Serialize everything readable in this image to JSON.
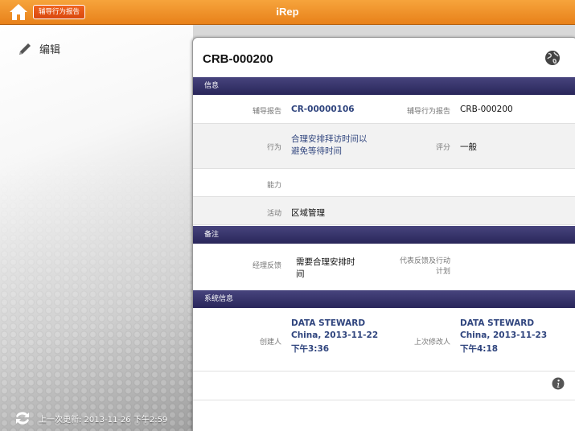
{
  "header": {
    "app_title": "iRep",
    "breadcrumb_label": "辅导行为报告"
  },
  "sidebar": {
    "edit_label": "编辑",
    "last_update": "上一次更新: 2013-11-26 下午2:59"
  },
  "record": {
    "title": "CRB-000200",
    "sections": {
      "info": "信息",
      "notes": "备注",
      "system": "系统信息"
    },
    "fields": {
      "coaching_report_label": "辅导报告",
      "coaching_report_value": "CR-00000106",
      "behavior_report_label": "辅导行为报告",
      "behavior_report_value": "CRB-000200",
      "behavior_label": "行为",
      "behavior_value_line1": "合理安排拜访时间以",
      "behavior_value_line2": "避免等待时间",
      "rating_label": "评分",
      "rating_value": "一般",
      "ability_label": "能力",
      "activity_label": "活动",
      "activity_value": "区域管理",
      "manager_feedback_label": "经理反馈",
      "manager_feedback_line1": "需要合理安排时",
      "manager_feedback_line2": "间",
      "rep_feedback_label_line1": "代表反馈及行动",
      "rep_feedback_label_line2": "计划",
      "created_by_label": "创建人",
      "created_by_line1": "DATA STEWARD",
      "created_by_line2": "China, 2013-11-22",
      "created_by_line3": "下午3:36",
      "modified_by_label": "上次修改人",
      "modified_by_line1": "DATA STEWARD",
      "modified_by_line2": "China, 2013-11-23",
      "modified_by_line3": "下午4:18"
    }
  },
  "colors": {
    "topbar": "#f0922c",
    "section_header": "#3a3770",
    "link": "#30457e"
  }
}
